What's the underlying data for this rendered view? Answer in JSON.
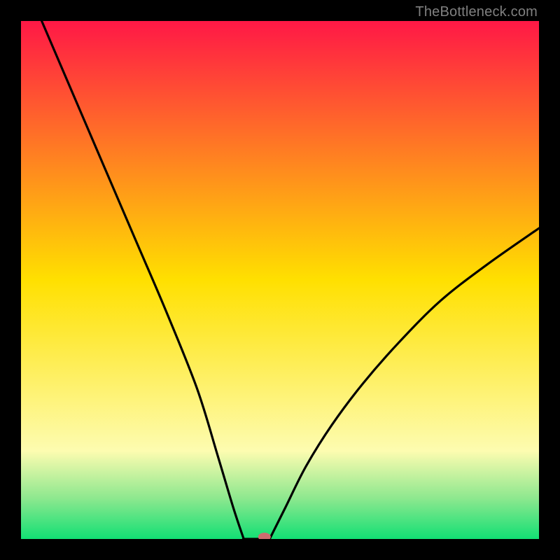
{
  "watermark": "TheBottleneck.com",
  "chart_data": {
    "type": "line",
    "title": "",
    "xlabel": "",
    "ylabel": "",
    "xlim": [
      0,
      100
    ],
    "ylim": [
      0,
      100
    ],
    "background_gradient": {
      "segments": [
        {
          "at": 0,
          "color": "#ff1846"
        },
        {
          "at": 50,
          "color": "#ffe000"
        },
        {
          "at": 83,
          "color": "#fdfcb0"
        },
        {
          "at": 92,
          "color": "#8fe88f"
        },
        {
          "at": 100,
          "color": "#12df74"
        }
      ]
    },
    "series": [
      {
        "name": "left-arm",
        "x": [
          4,
          10,
          16,
          22,
          28,
          34,
          38,
          41,
          43
        ],
        "y": [
          100,
          86,
          72,
          58,
          44,
          29,
          16,
          6,
          0
        ]
      },
      {
        "name": "floor",
        "x": [
          43,
          46,
          48
        ],
        "y": [
          0,
          0,
          0
        ]
      },
      {
        "name": "right-arm",
        "x": [
          48,
          51,
          55,
          60,
          66,
          73,
          81,
          90,
          100
        ],
        "y": [
          0,
          6,
          14,
          22,
          30,
          38,
          46,
          53,
          60
        ]
      }
    ],
    "marker": {
      "x": 47,
      "y": 0,
      "color": "#cf6b6f"
    }
  }
}
